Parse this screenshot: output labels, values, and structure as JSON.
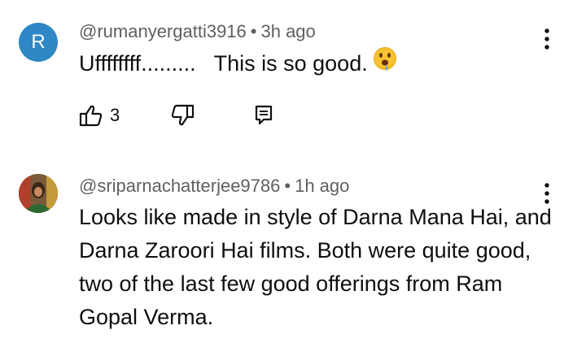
{
  "comments": [
    {
      "avatar_letter": "R",
      "avatar_color": "#2f87c5",
      "handle": "@rumanyergatti3916",
      "separator": "•",
      "time": "3h ago",
      "text": "Uffffffff.........   This is so good.",
      "emoji_icon": "drooling-face-icon",
      "likes": "3"
    },
    {
      "handle": "@sriparnachatterjee9786",
      "separator": "•",
      "time": "1h ago",
      "text": "Looks like made in style of Darna Mana Hai, and Darna Zaroori Hai films. Both were quite good, two of the last few good offerings from Ram Gopal Verma."
    }
  ],
  "icons": {
    "menu": "more-vertical-icon",
    "like": "thumbs-up-icon",
    "dislike": "thumbs-down-icon",
    "reply": "reply-icon"
  }
}
